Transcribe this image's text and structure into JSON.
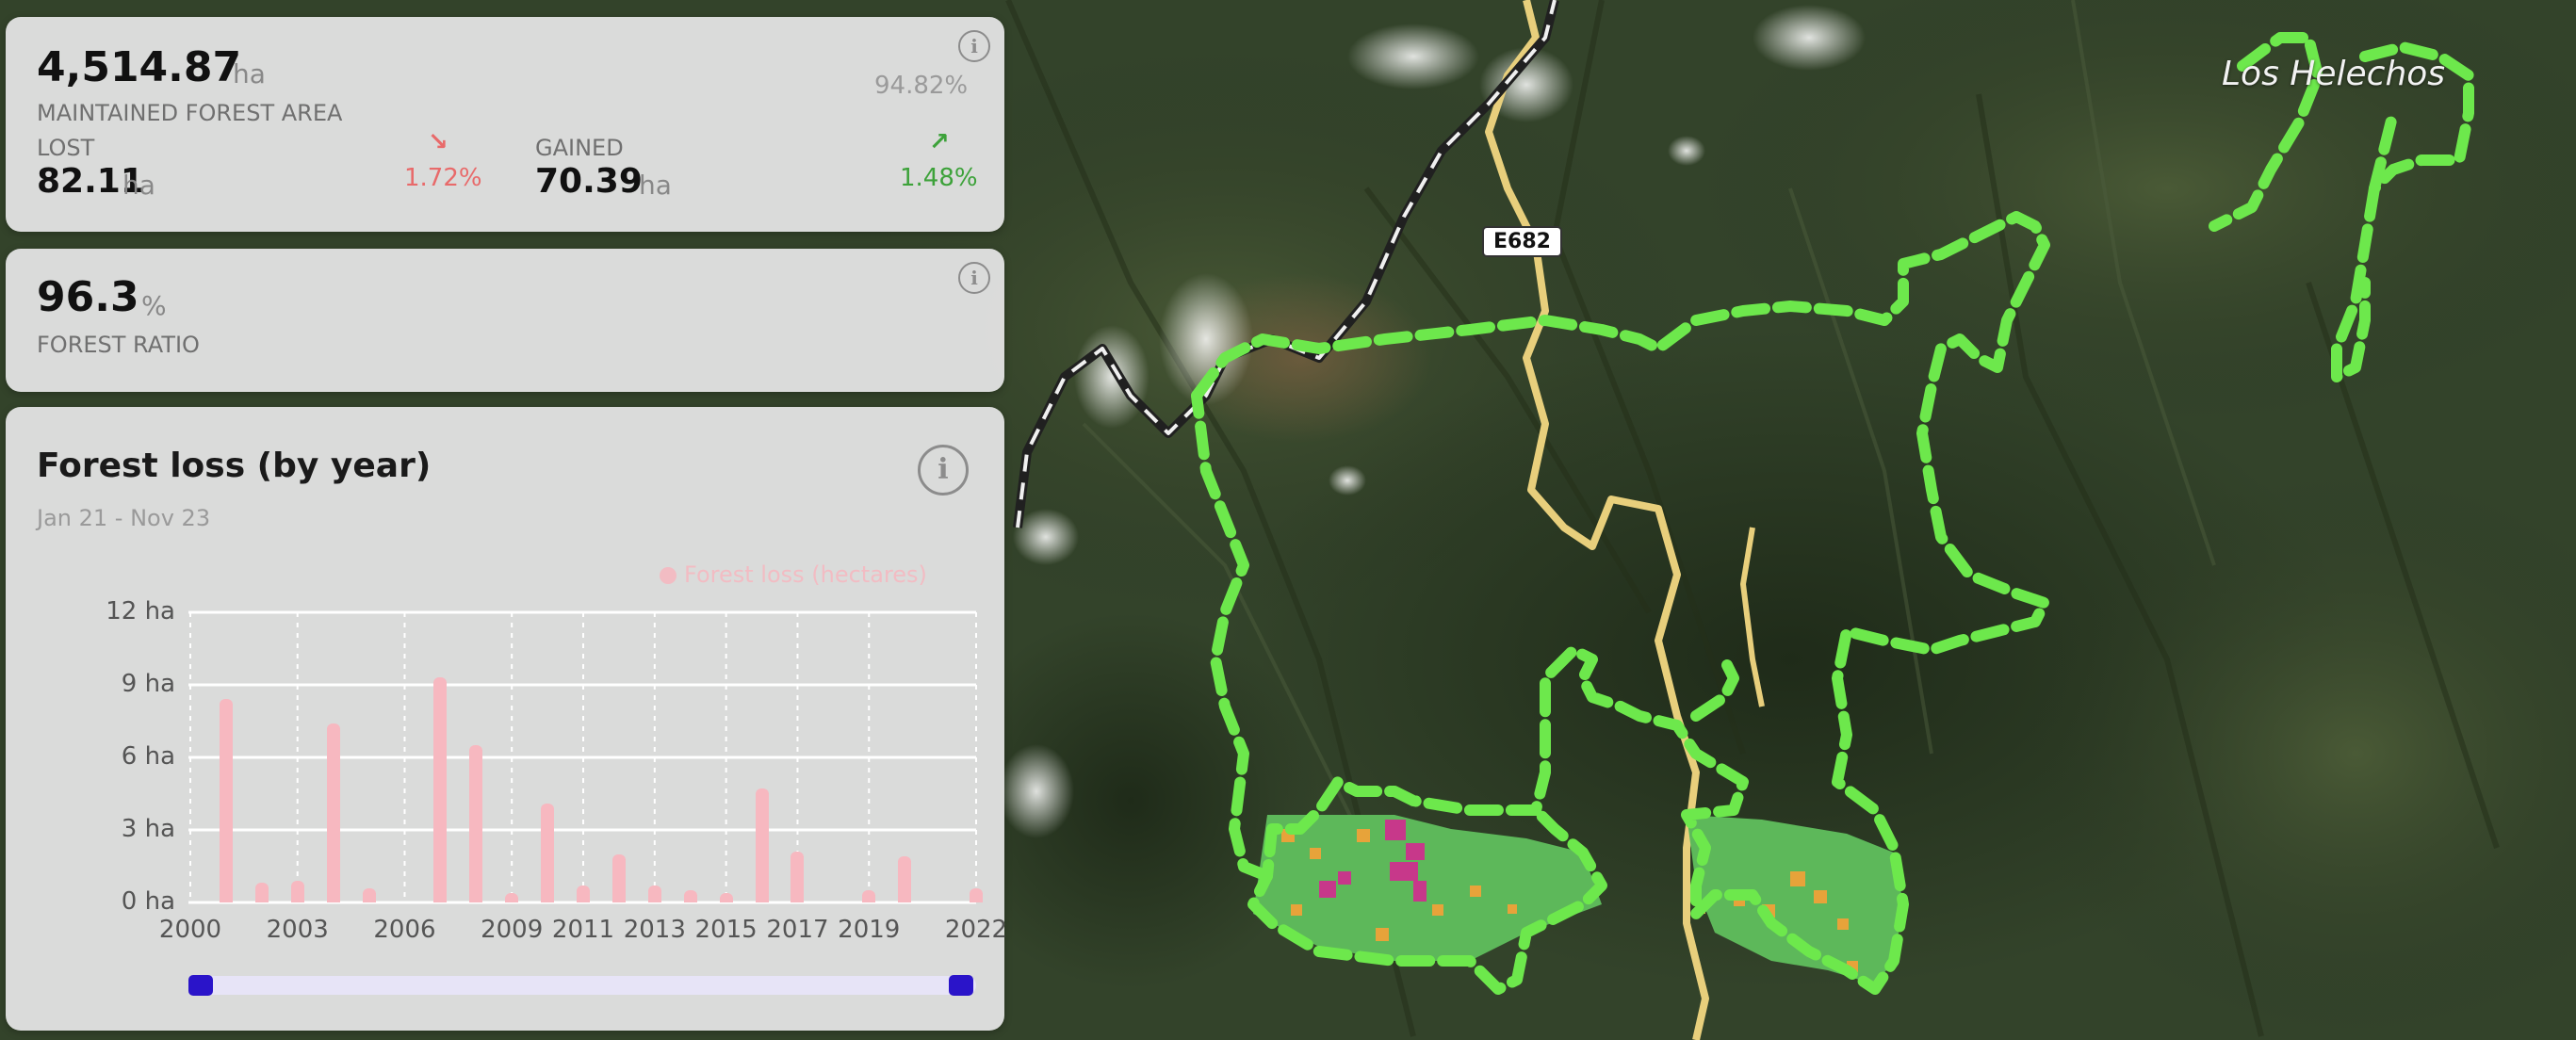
{
  "stats": {
    "maintained": {
      "value": "4,514.87",
      "unit": "ha",
      "label": "MAINTAINED FOREST AREA",
      "percent": "94.82%"
    },
    "lost": {
      "label": "LOST",
      "value": "82.11",
      "unit": "ha",
      "percent": "1.72%",
      "arrow": "↘",
      "color": "#e86a6a"
    },
    "gained": {
      "label": "GAINED",
      "value": "70.39",
      "unit": "ha",
      "percent": "1.48%",
      "arrow": "↗",
      "color": "#3da23a"
    }
  },
  "ratio": {
    "value": "96.3",
    "unit": "%",
    "label": "FOREST RATIO"
  },
  "info_icon_glyph": "i",
  "loss_chart": {
    "title": "Forest loss (by year)",
    "date_range": "Jan 21 - Nov 23",
    "legend": "Forest loss (hectares)",
    "bar_color": "#f7b8c0",
    "slider_color": "#2a14c9",
    "slider_range": [
      2000,
      2022
    ]
  },
  "chart_data": {
    "type": "bar",
    "categories": [
      "2000",
      "2001",
      "2002",
      "2003",
      "2004",
      "2005",
      "2006",
      "2007",
      "2008",
      "2009",
      "2010",
      "2011",
      "2012",
      "2013",
      "2014",
      "2015",
      "2016",
      "2017",
      "2018",
      "2019",
      "2020",
      "2021",
      "2022"
    ],
    "values": [
      0,
      8.4,
      0.8,
      0.9,
      7.4,
      0.6,
      0,
      9.3,
      6.5,
      0.4,
      4.1,
      0.7,
      2.0,
      0.7,
      0.5,
      0.4,
      4.7,
      2.1,
      0,
      0.5,
      1.9,
      0,
      0.6
    ],
    "x_tick_labels": [
      "2000",
      "2003",
      "2006",
      "2009",
      "2011",
      "2013",
      "2015",
      "2017",
      "2019",
      "2022"
    ],
    "y_tick_labels": [
      "12 ha",
      "9 ha",
      "6 ha",
      "3 ha",
      "0 ha"
    ],
    "ylim": [
      0,
      12
    ],
    "grid": true
  },
  "map": {
    "place_label": "Los Helechos",
    "road_badge": "E682",
    "boundary_color": "#6de84c",
    "road_color": "#e8cf7c"
  }
}
